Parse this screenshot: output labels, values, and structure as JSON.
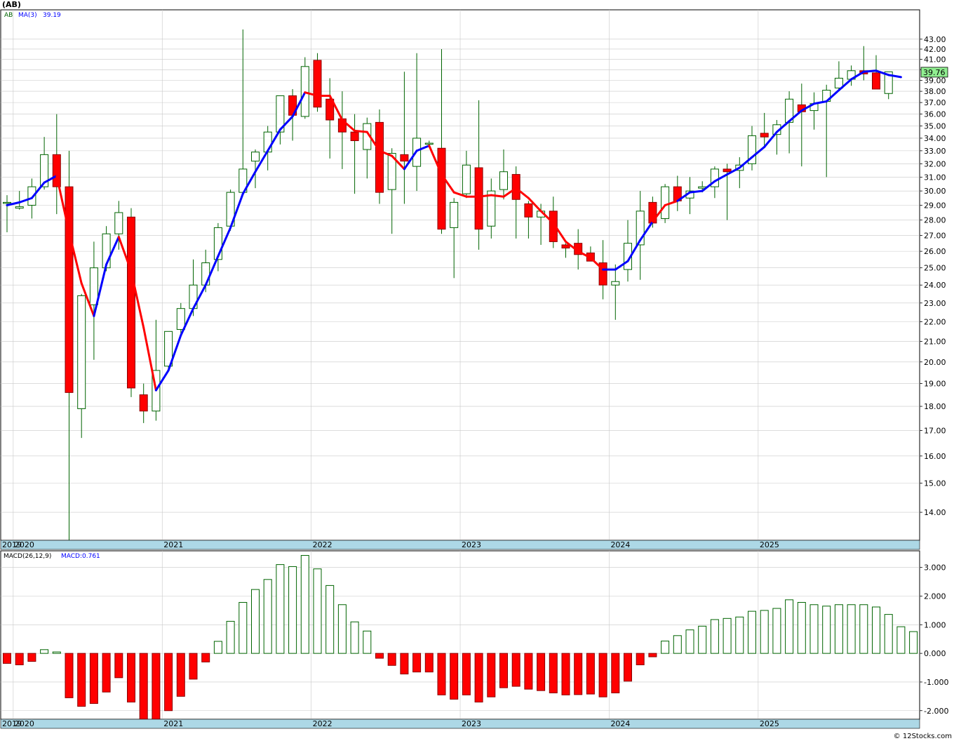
{
  "symbol_title": "(AB)",
  "footer": "© 12Stocks.com",
  "colors": {
    "up_body": "#ffffff",
    "up_border": "#006400",
    "down_body": "#ff0000",
    "down_border": "#8b0000",
    "wick": "#006400",
    "ma_up": "#0000ff",
    "ma_down": "#ff0000",
    "grid": "#c8c8c8",
    "axis_band": "#add8e6",
    "last_price_box": "#90ee90"
  },
  "chart_data": [
    {
      "type": "candlestick",
      "title": "",
      "legend": {
        "symbol": "AB",
        "ma_label": "MA(3)",
        "ma_value": "39.19"
      },
      "last_price_label": "39.76",
      "x_labels": [
        "2019",
        "2020",
        "2021",
        "2022",
        "2023",
        "2024",
        "2025"
      ],
      "y_ticks": [
        14,
        15,
        16,
        17,
        18,
        19,
        20,
        21,
        22,
        23,
        24,
        25,
        26,
        27,
        28,
        29,
        30,
        31,
        32,
        33,
        34,
        35,
        36,
        37,
        38,
        39,
        40,
        41,
        42,
        43
      ],
      "y_scale": "log",
      "ylim": [
        13.1,
        46.1
      ],
      "candles": [
        {
          "date": "2019-12",
          "o": 29.2,
          "h": 29.7,
          "l": 27.2,
          "c": 29.2
        },
        {
          "date": "2020-01",
          "o": 28.8,
          "h": 30.0,
          "l": 28.7,
          "c": 28.9
        },
        {
          "date": "2020-02",
          "o": 29.0,
          "h": 30.9,
          "l": 28.1,
          "c": 30.3
        },
        {
          "date": "2020-03",
          "o": 30.3,
          "h": 34.1,
          "l": 30.1,
          "c": 32.7
        },
        {
          "date": "2020-04",
          "o": 32.7,
          "h": 36.0,
          "l": 28.4,
          "c": 30.3
        },
        {
          "date": "2020-05",
          "o": 30.3,
          "h": 33.0,
          "l": 12.9,
          "c": 18.6
        },
        {
          "date": "2020-06",
          "o": 17.9,
          "h": 23.5,
          "l": 16.7,
          "c": 23.4
        },
        {
          "date": "2020-07",
          "o": 22.9,
          "h": 26.6,
          "l": 20.1,
          "c": 25.0
        },
        {
          "date": "2020-08",
          "o": 25.0,
          "h": 27.6,
          "l": 24.8,
          "c": 27.1
        },
        {
          "date": "2020-09",
          "o": 27.1,
          "h": 29.3,
          "l": 26.1,
          "c": 28.5
        },
        {
          "date": "2020-10",
          "o": 28.2,
          "h": 28.8,
          "l": 18.4,
          "c": 18.8
        },
        {
          "date": "2020-11",
          "o": 18.5,
          "h": 19.0,
          "l": 17.3,
          "c": 17.8
        },
        {
          "date": "2020-12",
          "o": 17.8,
          "h": 22.1,
          "l": 17.4,
          "c": 19.6
        },
        {
          "date": "2021-01",
          "o": 19.8,
          "h": 21.3,
          "l": 19.6,
          "c": 21.5
        },
        {
          "date": "2021-02",
          "o": 21.6,
          "h": 23.0,
          "l": 21.3,
          "c": 22.7
        },
        {
          "date": "2021-03",
          "o": 22.7,
          "h": 25.5,
          "l": 22.3,
          "c": 24.0
        },
        {
          "date": "2021-04",
          "o": 24.0,
          "h": 26.1,
          "l": 23.6,
          "c": 25.3
        },
        {
          "date": "2021-05",
          "o": 25.5,
          "h": 27.8,
          "l": 24.8,
          "c": 27.5
        },
        {
          "date": "2021-06",
          "o": 27.6,
          "h": 30.1,
          "l": 27.3,
          "c": 29.9
        },
        {
          "date": "2021-07",
          "o": 29.9,
          "h": 44.0,
          "l": 29.9,
          "c": 31.6
        },
        {
          "date": "2021-08",
          "o": 32.2,
          "h": 33.1,
          "l": 30.2,
          "c": 32.9
        },
        {
          "date": "2021-09",
          "o": 32.9,
          "h": 35.0,
          "l": 31.5,
          "c": 34.5
        },
        {
          "date": "2021-10",
          "o": 34.5,
          "h": 37.6,
          "l": 33.5,
          "c": 37.6
        },
        {
          "date": "2021-11",
          "o": 37.6,
          "h": 38.2,
          "l": 33.8,
          "c": 35.9
        },
        {
          "date": "2021-12",
          "o": 35.8,
          "h": 41.2,
          "l": 35.6,
          "c": 40.3
        },
        {
          "date": "2022-01",
          "o": 40.9,
          "h": 41.6,
          "l": 36.2,
          "c": 36.6
        },
        {
          "date": "2022-02",
          "o": 37.3,
          "h": 39.2,
          "l": 32.4,
          "c": 35.5
        },
        {
          "date": "2022-03",
          "o": 35.6,
          "h": 38.0,
          "l": 31.6,
          "c": 34.5
        },
        {
          "date": "2022-04",
          "o": 34.5,
          "h": 36.0,
          "l": 29.8,
          "c": 33.8
        },
        {
          "date": "2022-05",
          "o": 33.1,
          "h": 35.7,
          "l": 30.9,
          "c": 35.2
        },
        {
          "date": "2022-06",
          "o": 35.3,
          "h": 36.4,
          "l": 29.1,
          "c": 29.9
        },
        {
          "date": "2022-07",
          "o": 30.1,
          "h": 33.2,
          "l": 27.1,
          "c": 32.8
        },
        {
          "date": "2022-08",
          "o": 32.7,
          "h": 39.8,
          "l": 29.1,
          "c": 32.2
        },
        {
          "date": "2022-09",
          "o": 31.8,
          "h": 41.6,
          "l": 30.0,
          "c": 34.0
        },
        {
          "date": "2022-10",
          "o": 33.6,
          "h": 33.8,
          "l": 33.5,
          "c": 33.6
        },
        {
          "date": "2022-11",
          "o": 33.2,
          "h": 42.0,
          "l": 27.1,
          "c": 27.4
        },
        {
          "date": "2022-12",
          "o": 27.5,
          "h": 29.5,
          "l": 24.4,
          "c": 29.2
        },
        {
          "date": "2023-01",
          "o": 29.8,
          "h": 33.0,
          "l": 29.5,
          "c": 31.9
        },
        {
          "date": "2023-02",
          "o": 31.7,
          "h": 37.2,
          "l": 26.1,
          "c": 27.4
        },
        {
          "date": "2023-03",
          "o": 27.6,
          "h": 30.9,
          "l": 26.8,
          "c": 30.0
        },
        {
          "date": "2023-04",
          "o": 30.1,
          "h": 33.1,
          "l": 29.4,
          "c": 31.4
        },
        {
          "date": "2023-05",
          "o": 31.2,
          "h": 31.8,
          "l": 26.8,
          "c": 29.4
        },
        {
          "date": "2023-06",
          "o": 29.1,
          "h": 29.3,
          "l": 26.8,
          "c": 28.2
        },
        {
          "date": "2023-07",
          "o": 28.2,
          "h": 29.1,
          "l": 26.4,
          "c": 28.6
        },
        {
          "date": "2023-08",
          "o": 28.6,
          "h": 29.6,
          "l": 26.2,
          "c": 26.6
        },
        {
          "date": "2023-09",
          "o": 26.4,
          "h": 26.5,
          "l": 25.6,
          "c": 26.2
        },
        {
          "date": "2023-10",
          "o": 26.5,
          "h": 27.4,
          "l": 24.9,
          "c": 25.8
        },
        {
          "date": "2023-11",
          "o": 25.9,
          "h": 26.3,
          "l": 25.4,
          "c": 25.4
        },
        {
          "date": "2023-12",
          "o": 25.3,
          "h": 26.7,
          "l": 23.2,
          "c": 24.0
        },
        {
          "date": "2024-01",
          "o": 24.0,
          "h": 25.2,
          "l": 22.1,
          "c": 24.2
        },
        {
          "date": "2024-02",
          "o": 24.9,
          "h": 28.0,
          "l": 24.2,
          "c": 26.5
        },
        {
          "date": "2024-03",
          "o": 26.4,
          "h": 30.0,
          "l": 24.3,
          "c": 28.6
        },
        {
          "date": "2024-04",
          "o": 29.2,
          "h": 29.6,
          "l": 27.5,
          "c": 27.8
        },
        {
          "date": "2024-05",
          "o": 28.1,
          "h": 30.5,
          "l": 27.8,
          "c": 30.3
        },
        {
          "date": "2024-06",
          "o": 30.3,
          "h": 31.1,
          "l": 28.6,
          "c": 29.3
        },
        {
          "date": "2024-07",
          "o": 29.5,
          "h": 31.0,
          "l": 28.4,
          "c": 30.0
        },
        {
          "date": "2024-08",
          "o": 30.2,
          "h": 30.7,
          "l": 29.9,
          "c": 30.3
        },
        {
          "date": "2024-09",
          "o": 30.3,
          "h": 31.8,
          "l": 29.5,
          "c": 31.6
        },
        {
          "date": "2024-10",
          "o": 31.6,
          "h": 32.0,
          "l": 28.0,
          "c": 31.4
        },
        {
          "date": "2024-11",
          "o": 31.5,
          "h": 32.5,
          "l": 30.2,
          "c": 31.9
        },
        {
          "date": "2024-12",
          "o": 32.0,
          "h": 35.0,
          "l": 31.5,
          "c": 34.2
        },
        {
          "date": "2025-01",
          "o": 34.4,
          "h": 36.1,
          "l": 33.4,
          "c": 34.1
        },
        {
          "date": "2025-02",
          "o": 34.3,
          "h": 35.5,
          "l": 32.7,
          "c": 35.1
        },
        {
          "date": "2025-03",
          "o": 35.3,
          "h": 38.0,
          "l": 32.8,
          "c": 37.3
        },
        {
          "date": "2025-04",
          "o": 36.8,
          "h": 38.7,
          "l": 31.8,
          "c": 36.2
        },
        {
          "date": "2025-05",
          "o": 36.3,
          "h": 37.9,
          "l": 34.7,
          "c": 36.9
        },
        {
          "date": "2025-06",
          "o": 37.1,
          "h": 38.6,
          "l": 31.0,
          "c": 38.1
        },
        {
          "date": "2025-07",
          "o": 38.3,
          "h": 40.8,
          "l": 38.1,
          "c": 39.2
        },
        {
          "date": "2025-08",
          "o": 39.1,
          "h": 40.4,
          "l": 38.5,
          "c": 39.9
        },
        {
          "date": "2025-09",
          "o": 39.9,
          "h": 42.3,
          "l": 39.0,
          "c": 39.6
        },
        {
          "date": "2025-10",
          "o": 39.7,
          "h": 41.4,
          "l": 38.7,
          "c": 38.2
        },
        {
          "date": "2025-11",
          "o": 37.8,
          "h": 39.8,
          "l": 37.3,
          "c": 39.8
        }
      ],
      "ma": [
        29.0,
        29.2,
        29.5,
        30.6,
        31.1,
        27.2,
        24.1,
        22.3,
        25.2,
        26.9,
        24.8,
        21.7,
        18.7,
        19.6,
        21.3,
        22.7,
        24.0,
        25.7,
        27.5,
        29.8,
        31.4,
        33.0,
        34.7,
        35.8,
        37.9,
        37.6,
        37.6,
        35.5,
        34.6,
        34.5,
        33.0,
        32.6,
        31.6,
        33.0,
        33.4,
        31.2,
        29.9,
        29.6,
        29.6,
        29.7,
        29.6,
        30.2,
        29.5,
        28.6,
        27.8,
        26.6,
        26.0,
        25.6,
        24.9,
        24.9,
        25.4,
        26.7,
        27.9,
        29.0,
        29.3,
        29.9,
        30.0,
        30.7,
        31.2,
        31.7,
        32.5,
        33.3,
        34.5,
        35.4,
        36.3,
        36.9,
        37.1,
        38.1,
        39.1,
        39.8,
        39.9,
        39.5,
        39.3
      ],
      "ma_segments_up": [
        [
          0,
          4
        ],
        [
          7,
          9
        ],
        [
          12,
          24
        ],
        [
          27,
          27
        ],
        [
          32,
          34
        ],
        [
          38,
          38
        ],
        [
          41,
          41
        ],
        [
          48,
          52
        ],
        [
          54,
          58
        ],
        [
          59,
          62
        ],
        [
          63,
          72
        ]
      ]
    },
    {
      "type": "bar",
      "title": "",
      "legend": {
        "label": "MACD(26,12,9)",
        "value_label": "MACD:0.761"
      },
      "y_ticks": [
        -2,
        -1,
        0,
        1,
        2,
        3
      ],
      "y_tick_labels": [
        "-2.000",
        "-1.000",
        "0.000",
        "1.000",
        "2.000",
        "3.000"
      ],
      "ylim": [
        -2.3,
        3.58
      ],
      "values": [
        -0.35,
        -0.4,
        -0.28,
        0.13,
        0.05,
        -1.55,
        -1.85,
        -1.75,
        -1.35,
        -0.85,
        -1.7,
        -2.3,
        -2.3,
        -2.0,
        -1.5,
        -0.9,
        -0.3,
        0.42,
        1.12,
        1.78,
        2.23,
        2.58,
        3.1,
        3.03,
        3.42,
        2.95,
        2.37,
        1.7,
        1.1,
        0.78,
        -0.17,
        -0.42,
        -0.72,
        -0.65,
        -0.65,
        -1.45,
        -1.6,
        -1.45,
        -1.7,
        -1.52,
        -1.2,
        -1.15,
        -1.25,
        -1.3,
        -1.38,
        -1.45,
        -1.44,
        -1.42,
        -1.52,
        -1.38,
        -0.97,
        -0.4,
        -0.12,
        0.43,
        0.62,
        0.82,
        0.95,
        1.18,
        1.22,
        1.27,
        1.47,
        1.5,
        1.57,
        1.87,
        1.78,
        1.7,
        1.65,
        1.7,
        1.7,
        1.7,
        1.62,
        1.36,
        0.93,
        0.76
      ]
    }
  ]
}
